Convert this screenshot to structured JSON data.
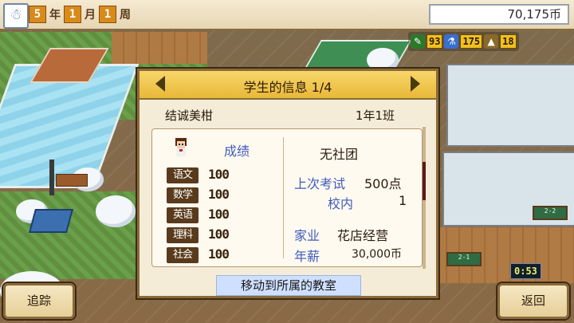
{
  "topbar": {
    "snow_icon": "snowman-icon",
    "year": "5",
    "year_unit": "年",
    "month": "1",
    "month_unit": "月",
    "week": "1",
    "week_unit": "周",
    "money": "70,175币"
  },
  "stats": {
    "items": [
      {
        "icon": "pencil-icon",
        "value": "93",
        "color": "#2a7a2a"
      },
      {
        "icon": "flask-icon",
        "value": "175",
        "color": "#3a6fd0"
      },
      {
        "icon": "weight-icon",
        "value": "18",
        "color": "#8a6a2a"
      }
    ]
  },
  "dialog": {
    "title": "学生的信息 1/4",
    "student_name": "结诚美柑",
    "student_class": "1年1班",
    "grades_label": "成绩",
    "subjects": [
      {
        "name": "语文",
        "score": "100"
      },
      {
        "name": "数学",
        "score": "100"
      },
      {
        "name": "英语",
        "score": "100"
      },
      {
        "name": "理科",
        "score": "100"
      },
      {
        "name": "社会",
        "score": "100"
      }
    ],
    "club": "无社团",
    "last_exam_label": "上次考试",
    "last_exam_value": "500点",
    "school_rank_label": "校内",
    "school_rank_value": "1",
    "family_business_label": "家业",
    "family_business_value": "花店经营",
    "annual_income_label": "年薪",
    "annual_income_value": "30,000币",
    "move_button": "移动到所属的教室"
  },
  "buttons": {
    "track": "追踪",
    "back": "返回"
  },
  "world": {
    "clock": "0:53",
    "blackboard_1": "2-2",
    "blackboard_2": "2-1"
  }
}
